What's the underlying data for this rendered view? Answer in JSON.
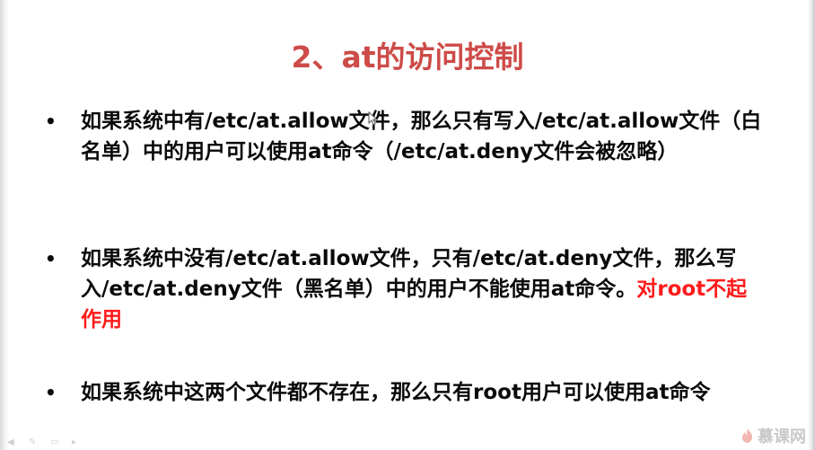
{
  "slide": {
    "title": "2、at的访问控制",
    "bullets": [
      {
        "marker": "•",
        "text": "如果系统中有/etc/at.allow文件，那么只有写入/etc/at.allow文件（白名单）中的用户可以使用at命令（/etc/at.deny文件会被忽略）"
      },
      {
        "marker": "•",
        "text": "如果系统中没有/etc/at.allow文件，只有/etc/at.deny文件，那么写入/etc/at.deny文件（黑名单）中的用户不能使用at命令。",
        "highlight": "对root不起作用"
      },
      {
        "marker": "•",
        "text": "如果系统中这两个文件都不存在，那么只有root用户可以使用at命令"
      }
    ]
  },
  "watermark": {
    "text": "慕课网",
    "icon": "flame-logo-icon"
  },
  "toolbar": {
    "icons": [
      "back-arrow-icon",
      "pen-icon",
      "slides-icon",
      "menu-icon"
    ]
  },
  "colors": {
    "title": "#cd4b48",
    "highlight": "#ff1a1a",
    "body_text": "#0a0a0a"
  }
}
